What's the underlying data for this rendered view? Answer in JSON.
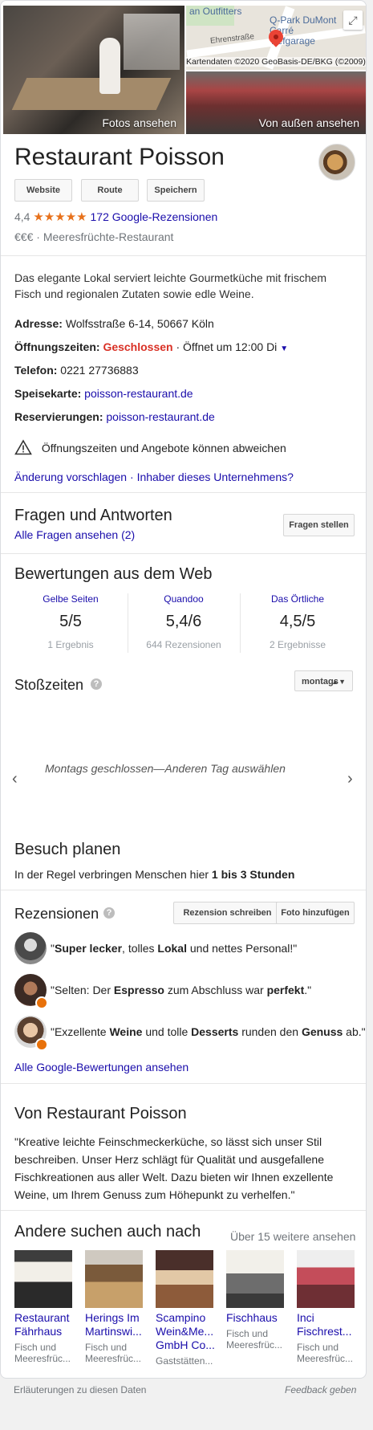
{
  "hero": {
    "photos_caption": "Fotos ansehen",
    "outside_caption": "Von außen ansehen",
    "map": {
      "street_label": "Ehrenstraße",
      "poi_label": "Q-Park DuMont Carré Tiefgarage",
      "shop_label": "an Outfitters",
      "copyright": "Kartendaten ©2020 GeoBasis-DE/BKG (©2009)",
      "expand_icon": "expand-icon"
    }
  },
  "business": {
    "name": "Restaurant Poisson",
    "buttons": [
      "Website",
      "Route",
      "Speichern"
    ],
    "rating": "4,4",
    "stars": "★★★★★",
    "star_fraction": 0.88,
    "reviews_link": "172 Google-Rezensionen",
    "price": "€€€",
    "dot": "·",
    "category": "Meeresfrüchte-Restaurant",
    "description": "Das elegante Lokal serviert leichte Gourmetküche mit frischem Fisch und regionalen Zutaten sowie edle Weine."
  },
  "info": {
    "address_label": "Adresse:",
    "address": "Wolfsstraße 6-14, 50667 Köln",
    "hours_label": "Öffnungszeiten:",
    "hours_status": "Geschlossen",
    "hours_next": "· Öffnet um 12:00 Di",
    "phone_label": "Telefon:",
    "phone": "0221 27736883",
    "menu_label": "Speisekarte:",
    "menu_link": "poisson-restaurant.de",
    "reservations_label": "Reservierungen:",
    "reservations_link": "poisson-restaurant.de",
    "warning": "Öffnungszeiten und Angebote können abweichen",
    "suggest_link": "Änderung vorschlagen",
    "owner_link": "Inhaber dieses Unternehmens?"
  },
  "qa": {
    "title": "Fragen und Antworten",
    "all_link": "Alle Fragen ansehen (2)",
    "ask_button": "Fragen stellen"
  },
  "web_reviews": {
    "title": "Bewertungen aus dem Web",
    "items": [
      {
        "source": "Gelbe Seiten",
        "score": "5/5",
        "count": "1 Ergebnis"
      },
      {
        "source": "Quandoo",
        "score": "5,4/6",
        "count": "644 Rezensionen"
      },
      {
        "source": "Das Örtliche",
        "score": "4,5/5",
        "count": "2 Ergebnisse"
      }
    ]
  },
  "popular_times": {
    "title": "Stoßzeiten",
    "help_icon": "help-icon",
    "day_select": "montags",
    "closed_text": "Montags geschlossen—Anderen Tag auswählen"
  },
  "visit": {
    "title": "Besuch planen",
    "text_prefix": "In der Regel verbringen Menschen hier",
    "duration": "1 bis 3 Stunden"
  },
  "reviews": {
    "title": "Rezensionen",
    "write_button": "Rezension schreiben",
    "photo_button": "Foto hinzufügen",
    "items": [
      {
        "parts": [
          "\"",
          "Super lecker",
          ", tolles ",
          "Lokal",
          " und nettes Personal!\""
        ]
      },
      {
        "parts": [
          "\"Selten: Der ",
          "Espresso",
          " zum Abschluss war ",
          "perfekt",
          ".\""
        ]
      },
      {
        "parts": [
          "\"Exzellente ",
          "Weine",
          " und tolle ",
          "Desserts",
          " runden den ",
          "Genuss",
          " ab.\""
        ]
      }
    ],
    "all_link": "Alle Google-Bewertungen ansehen"
  },
  "from_business": {
    "title": "Von Restaurant Poisson",
    "text": "\"Kreative leichte Feinschmeckerküche, so lässt sich unser Stil beschreiben. Unser Herz schlägt für Qualität und ausgefallene Fischkreationen aus aller Welt. Dazu bieten wir Ihnen exzellente Weine, um Ihrem Genuss zum Höhepunkt zu verhelfen.\""
  },
  "also_search": {
    "title": "Andere suchen auch nach",
    "more_link": "Über 15 weitere ansehen",
    "items": [
      {
        "name1": "Restaurant",
        "name2": "Fährhaus",
        "sub1": "Fisch und",
        "sub2": "Meeresfrüc..."
      },
      {
        "name1": "Herings Im",
        "name2": "Martinswi...",
        "sub1": "Fisch und",
        "sub2": "Meeresfrüc..."
      },
      {
        "name1": "Scampino",
        "name2": "Wein&Me...",
        "name3": "GmbH Co...",
        "sub1": "Gaststätten..."
      },
      {
        "name1": "Fischhaus",
        "sub1": "Fisch und",
        "sub2": "Meeresfrüc..."
      },
      {
        "name1": "Inci",
        "name2": "Fischrest...",
        "sub1": "Fisch und",
        "sub2": "Meeresfrüc..."
      }
    ]
  },
  "footer": {
    "explain": "Erläuterungen zu diesen Daten",
    "feedback": "Feedback geben"
  }
}
